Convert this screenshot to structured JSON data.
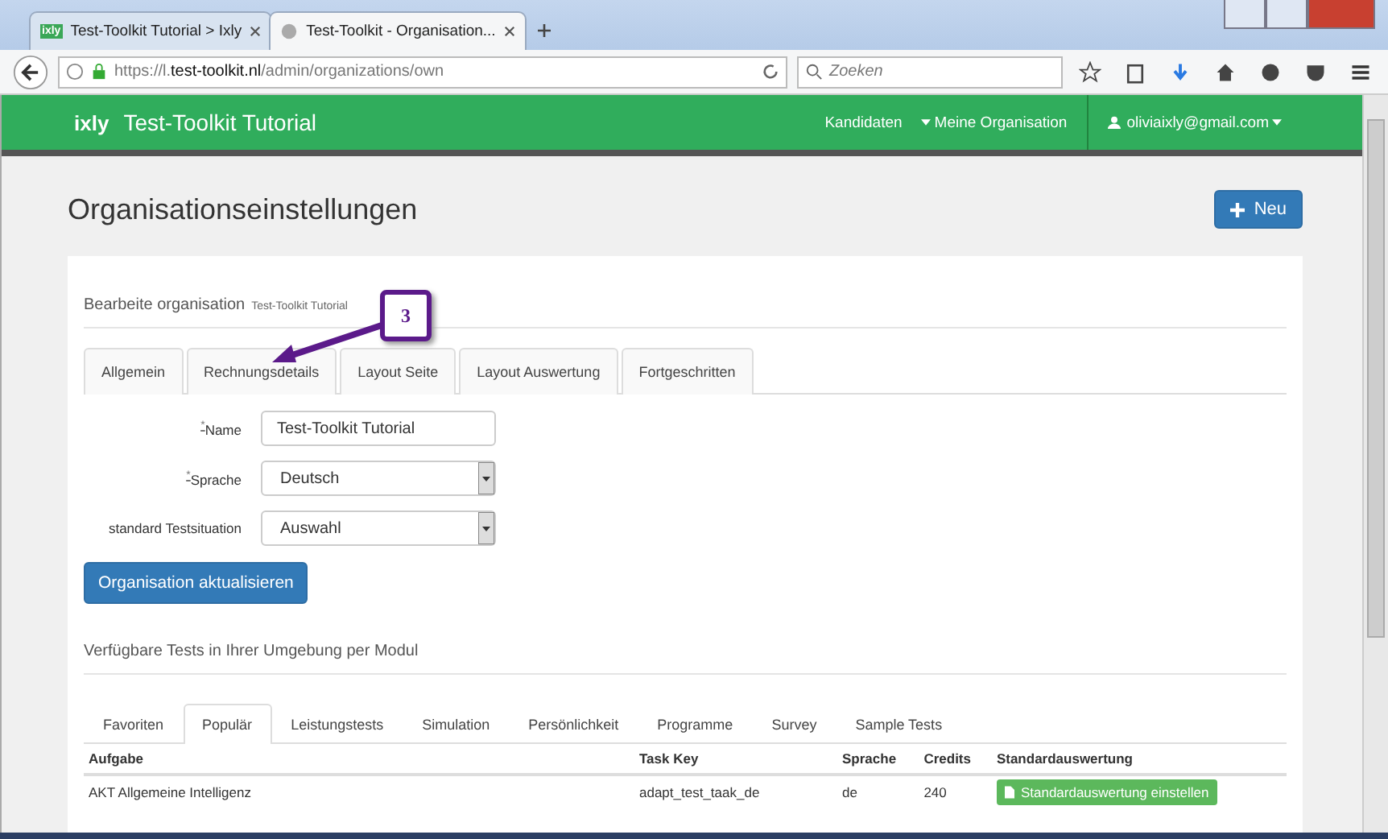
{
  "browser": {
    "tabs": [
      {
        "label": "Test-Toolkit Tutorial > Ixly",
        "favicon": "ixly",
        "selected": false
      },
      {
        "label": "Test-Toolkit - Organisation...",
        "selected": true
      }
    ],
    "url_prefix": "https://l.",
    "url_host": "test-toolkit.nl",
    "url_path": "/admin/organizations/own",
    "search_placeholder": "Zoeken"
  },
  "navbar": {
    "logo": "ixly",
    "title": "Test-Toolkit Tutorial",
    "links": [
      {
        "label": "Kandidaten",
        "caret": false
      },
      {
        "label": "Meine Organisation",
        "caret": true
      }
    ],
    "user": "oliviaixly@gmail.com"
  },
  "page": {
    "title": "Organisationseinstellungen",
    "new_button": "Neu"
  },
  "edit": {
    "heading": "Bearbeite organisation",
    "subheading": "Test-Toolkit Tutorial",
    "tabs": [
      {
        "label": "Allgemein",
        "selected": false
      },
      {
        "label": "Rechnungsdetails",
        "selected": false
      },
      {
        "label": "Layout Seite",
        "selected": false
      },
      {
        "label": "Layout Auswertung",
        "selected": false
      },
      {
        "label": "Fortgeschritten",
        "selected": false
      }
    ],
    "callout": "3",
    "fields": [
      {
        "label": "Name",
        "marker": "*",
        "kind": "text",
        "value": "Test-Toolkit Tutorial"
      },
      {
        "label": "Sprache",
        "marker": "*",
        "kind": "select",
        "value": "Deutsch"
      },
      {
        "label": "standard Testsituation",
        "kind": "select",
        "value": "Auswahl"
      }
    ],
    "submit": "Organisation aktualisieren"
  },
  "tests": {
    "heading": "Verfügbare Tests in Ihrer Umgebung per Modul",
    "tabs": [
      {
        "label": "Favoriten",
        "selected": false
      },
      {
        "label": "Populär",
        "selected": true
      },
      {
        "label": "Leistungstests",
        "selected": false
      },
      {
        "label": "Simulation",
        "selected": false
      },
      {
        "label": "Persönlichkeit",
        "selected": false
      },
      {
        "label": "Programme",
        "selected": false
      },
      {
        "label": "Survey",
        "selected": false
      },
      {
        "label": "Sample Tests",
        "selected": false
      }
    ],
    "columns": [
      "Aufgabe",
      "Task Key",
      "Sprache",
      "Credits",
      "Standardauswertung"
    ],
    "rows": [
      {
        "task": "AKT Allgemeine Intelligenz",
        "key": "adapt_test_taak_de",
        "lang": "de",
        "credits": "240",
        "action": "Standardauswertung einstellen"
      }
    ]
  }
}
